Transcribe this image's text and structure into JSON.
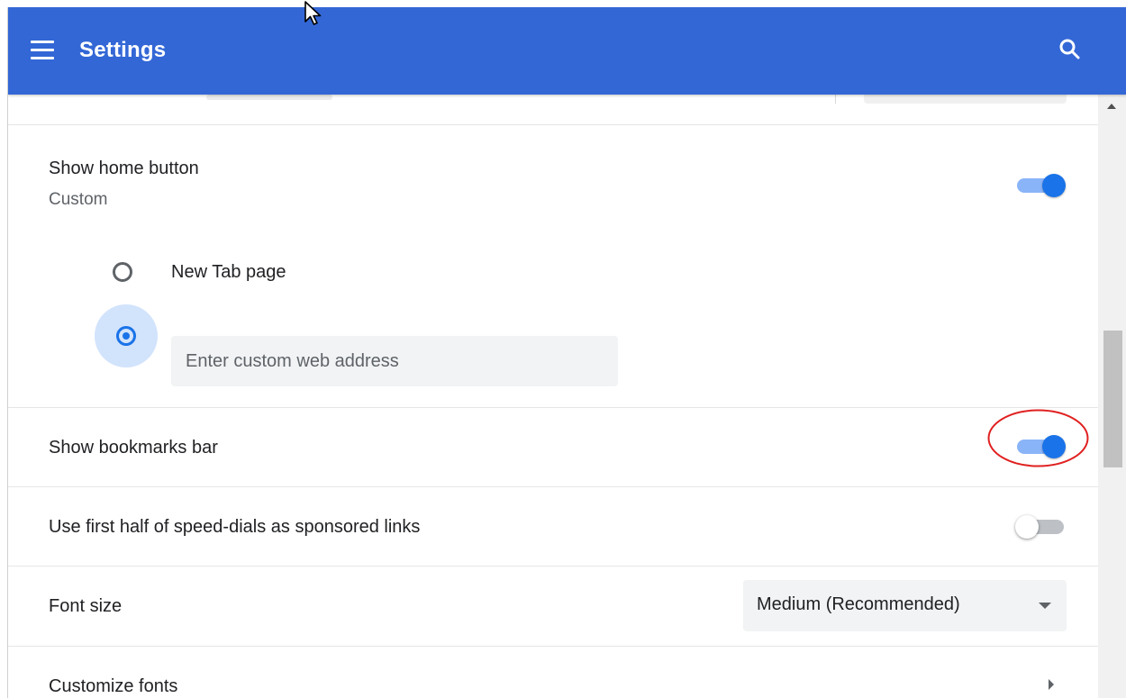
{
  "header": {
    "title": "Settings",
    "menu_icon": "hamburger-menu-icon",
    "search_icon": "search-icon",
    "background_color": "#3367d6"
  },
  "home_button": {
    "label": "Show home button",
    "sublabel": "Custom",
    "enabled": true,
    "options": [
      {
        "label": "New Tab page",
        "selected": false
      },
      {
        "label": "",
        "selected": true
      }
    ],
    "custom_address_placeholder": "Enter custom web address",
    "custom_address_value": ""
  },
  "bookmarks_bar": {
    "label": "Show bookmarks bar",
    "enabled": true,
    "highlighted": true,
    "highlight_color": "#e02020"
  },
  "sponsored_links": {
    "label": "Use first half of speed-dials as sponsored links",
    "enabled": false
  },
  "font_size": {
    "label": "Font size",
    "selected_value": "Medium (Recommended)"
  },
  "customize_fonts": {
    "label": "Customize fonts"
  },
  "colors": {
    "accent": "#1a73e8",
    "toggle_track_on": "#8ab4f8",
    "radio_halo": "#d2e3fc"
  }
}
